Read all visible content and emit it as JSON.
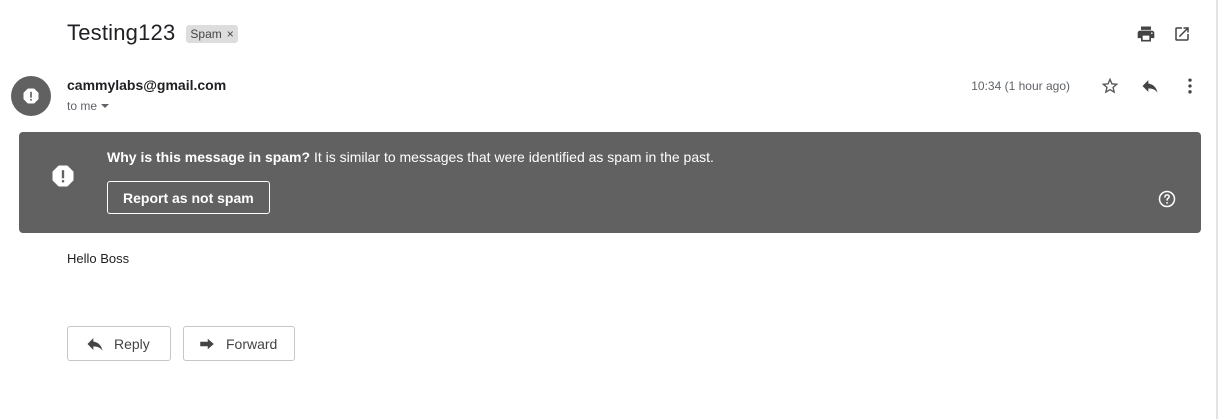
{
  "email": {
    "subject": "Testing123",
    "label": "Spam",
    "label_remove_glyph": "×",
    "sender": "cammylabs@gmail.com",
    "recipient": "to me",
    "timestamp": "10:34 (1 hour ago)",
    "body": "Hello Boss"
  },
  "spam_banner": {
    "heading": "Why is this message in spam?",
    "explanation": " It is similar to messages that were identified as spam in the past.",
    "report_button": "Report as not spam"
  },
  "actions": {
    "reply_label": "Reply",
    "forward_label": "Forward"
  },
  "icons": {
    "toolbar": [
      "print-icon",
      "open-in-new-window-icon"
    ],
    "message": [
      "star-icon",
      "reply-icon",
      "more-vert-icon"
    ],
    "avatar": "spam-warning-icon",
    "banner": [
      "spam-warning-icon",
      "help-icon"
    ]
  },
  "colors": {
    "banner_bg": "#616161",
    "avatar_bg": "#616161",
    "label_bg": "#dddddd",
    "text_primary": "#202124",
    "text_secondary": "#5f6368"
  }
}
